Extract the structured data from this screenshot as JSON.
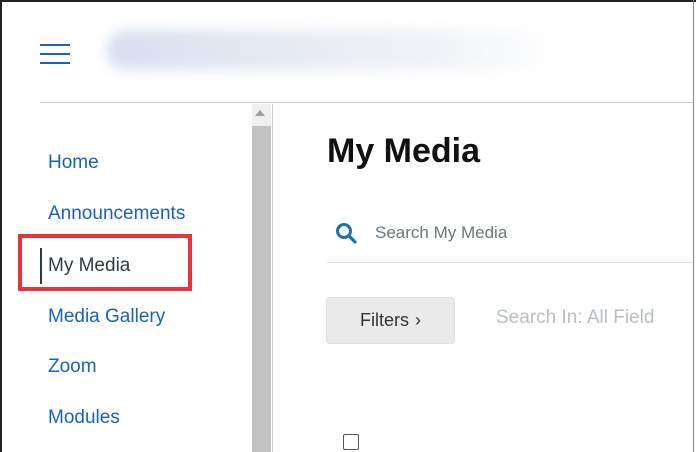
{
  "nav": {
    "items": [
      {
        "label": "Home",
        "active": false
      },
      {
        "label": "Announcements",
        "active": false
      },
      {
        "label": "My Media",
        "active": true
      },
      {
        "label": "Media Gallery",
        "active": false
      },
      {
        "label": "Zoom",
        "active": false
      },
      {
        "label": "Modules",
        "active": false
      }
    ]
  },
  "main": {
    "title": "My Media",
    "search": {
      "placeholder": "Search My Media",
      "value": ""
    },
    "filters_label": "Filters",
    "filters_icon": "chevron-right-icon",
    "search_in_label": "Search In: All Field"
  },
  "colors": {
    "link": "#1a62b8",
    "active_text": "#2d3b45",
    "highlight": "#e8333c",
    "search_icon": "#1f6fa6"
  }
}
